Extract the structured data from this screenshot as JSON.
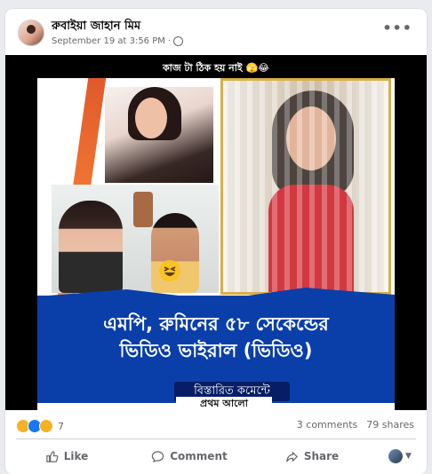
{
  "post": {
    "author": "রুবাইয়া জাহান মিম",
    "timestamp": "September 19 at 3:56 PM",
    "privacy_icon": "globe-icon",
    "more_label": "•••"
  },
  "media": {
    "caption": "কাজ টা ঠিক হয় নাই 🫣😂",
    "headline_line1": "এমপি, রুমিনের ৫৮ সেকেন্ডের",
    "headline_line2": "ভিডিও ভাইরাল (ভিডিও)",
    "subtext": "বিস্তারিত কমেন্টে",
    "logo_text": "প্রথম আলো",
    "colors": {
      "poster_blue": "#0a3faa",
      "accent_orange": "#e05a2a",
      "gold_frame": "#d8b048"
    }
  },
  "stats": {
    "reactions": [
      "haha",
      "like",
      "wow"
    ],
    "reaction_count": "7",
    "comments": "3 comments",
    "shares": "79 shares"
  },
  "actions": {
    "like": "Like",
    "comment": "Comment",
    "share": "Share"
  }
}
